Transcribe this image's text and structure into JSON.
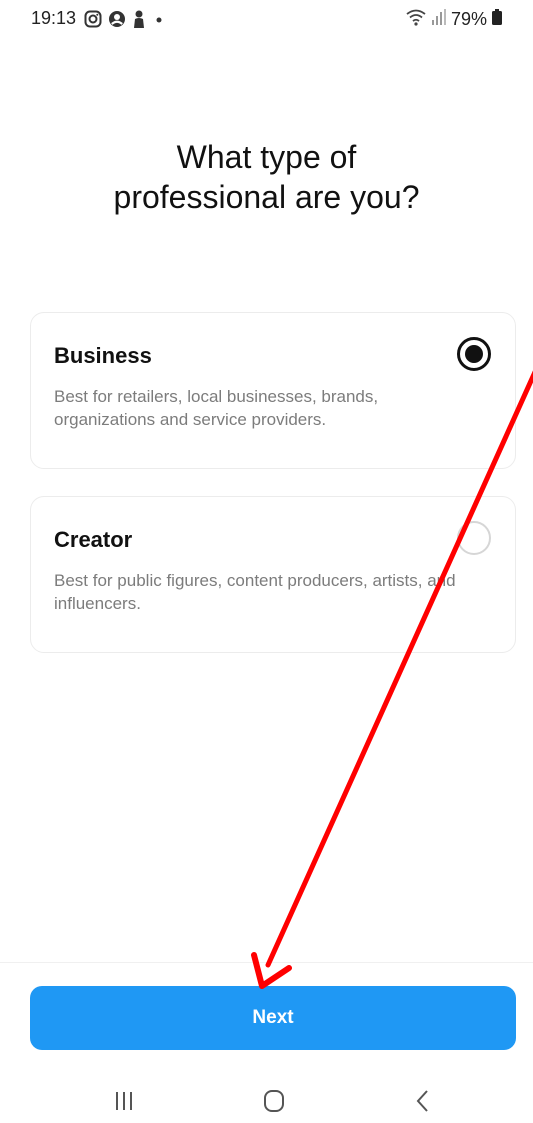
{
  "status_bar": {
    "time": "19:13",
    "battery": "79%",
    "icons": [
      "instagram-icon",
      "account-circle-icon",
      "person-icon",
      "dot-icon",
      "wifi-icon",
      "signal-icon",
      "battery-icon"
    ]
  },
  "page": {
    "title": "What type of professional are you?"
  },
  "options": [
    {
      "title": "Business",
      "description": "Best for retailers, local businesses, brands, organizations and service providers.",
      "selected": true
    },
    {
      "title": "Creator",
      "description": "Best for public figures, content producers, artists, and influencers.",
      "selected": false
    }
  ],
  "footer": {
    "next_label": "Next"
  },
  "nav_bar": {
    "icons": [
      "recent-apps-icon",
      "home-icon",
      "back-icon"
    ]
  },
  "colors": {
    "accent": "#1f98f4",
    "annotation": "#ff0000"
  }
}
